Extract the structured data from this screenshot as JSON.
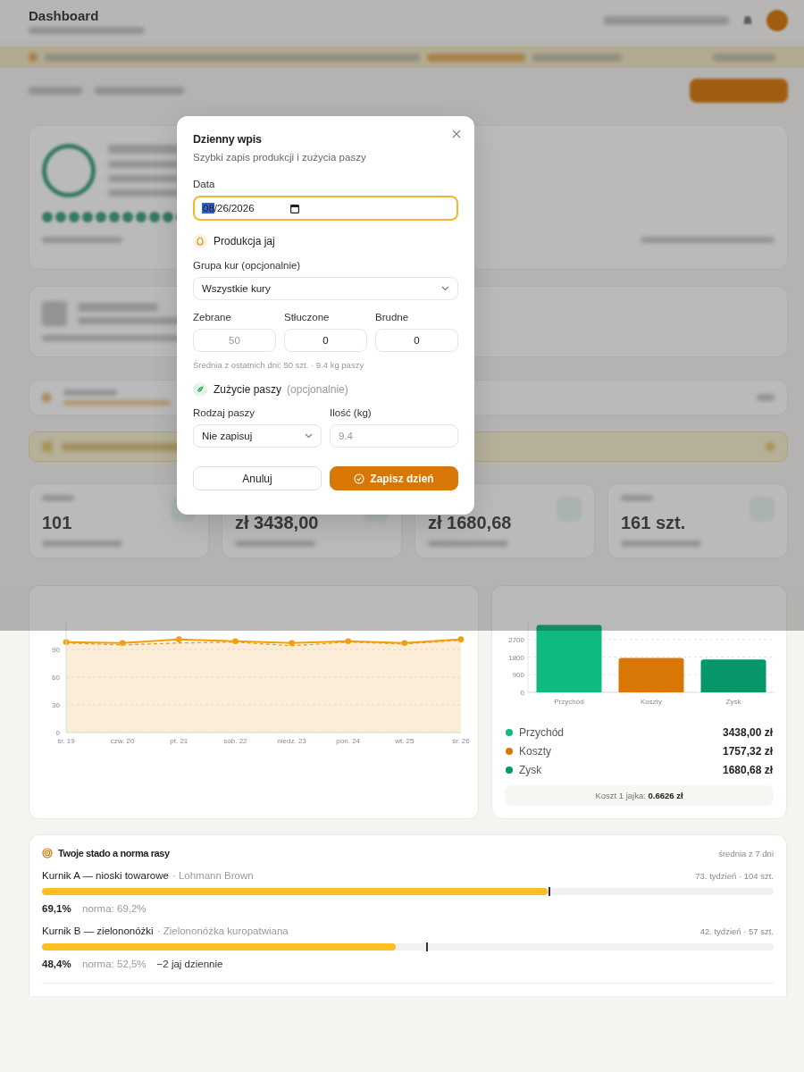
{
  "header": {
    "title": "Dashboard"
  },
  "stats": [
    {
      "value": "101"
    },
    {
      "value": "zł 3438,00"
    },
    {
      "value": "zł 1680,68"
    },
    {
      "value": "161 szt."
    }
  ],
  "modal": {
    "title": "Dzienny wpis",
    "subtitle": "Szybki zapis produkcji i zużycia paszy",
    "date_field": {
      "label": "Data",
      "value": "08/26/2026",
      "focused": true
    },
    "egg_section": {
      "title": "Produkcja jaj",
      "group_select": {
        "label": "Grupa kur (opcjonalnie)",
        "value": "Wszystkie kury"
      },
      "counts": [
        {
          "label": "Zebrane",
          "placeholder": "50"
        },
        {
          "label": "Stłuczone",
          "value": "0"
        },
        {
          "label": "Brudne",
          "value": "0"
        }
      ],
      "hint": "Średnia z ostatnich dni: 50 szt. · 9.4 kg paszy"
    },
    "feed_section": {
      "title": "Zużycie paszy",
      "note": "(opcjonalnie)",
      "fields": [
        {
          "kind": "select",
          "label": "Rodzaj paszy",
          "value": "Nie zapisuj"
        },
        {
          "kind": "input",
          "label": "Ilość (kg)",
          "placeholder": "9.4"
        }
      ]
    },
    "buttons": [
      {
        "kind": "secondary",
        "label": "Anuluj"
      },
      {
        "kind": "primary",
        "label": "Zapisz dzień"
      }
    ]
  },
  "production_chart": {
    "chart_data": {
      "type": "area",
      "grid": true,
      "categories": [
        "śr. 19",
        "czw. 20",
        "pt. 21",
        "sob. 22",
        "niedz. 23",
        "pon. 24",
        "wt. 25",
        "śr. 26"
      ],
      "series": [
        {
          "color": "#f59e0b",
          "marker": true,
          "values": [
            98,
            97,
            101,
            99,
            97,
            99,
            97,
            101
          ]
        },
        {
          "color": "#e89a2c",
          "line_style": "dashed",
          "values": [
            97,
            95,
            97,
            98,
            94,
            98,
            96,
            100
          ]
        }
      ],
      "ylim": [
        0,
        120
      ],
      "yticks": [
        0,
        30,
        60,
        90
      ]
    }
  },
  "finance": {
    "chart_data": {
      "type": "bar",
      "grid": true,
      "categories": [
        "Przychód",
        "Koszty",
        "Zysk"
      ],
      "series": [
        {
          "values": [
            3440,
            1760,
            1680
          ]
        }
      ],
      "ylim": [
        0,
        3600
      ],
      "yticks": [
        0,
        900,
        1800,
        2700
      ]
    },
    "legend": [
      {
        "label": "Przychód",
        "value": "3438,00 zł",
        "color": "#10b981"
      },
      {
        "label": "Koszty",
        "value": "1757,32 zł",
        "color": "#d97706"
      },
      {
        "label": "Zysk",
        "value": "1680,68 zł",
        "color": "#059669"
      }
    ],
    "cost_note": "Koszt 1 jajka: **0.6626 zł**"
  },
  "flock": {
    "title": "Twoje stado a norma rasy",
    "period": "średnia z 7 dni",
    "groups": [
      {
        "name": "Kurnik A — nioski towarowe",
        "breed": "· Lohmann Brown",
        "meta": "73. tydzień · 104 szt.",
        "level": 0.691,
        "target": {
          "level": 0.692
        },
        "rate": "69,1%",
        "norm": "norma: 69,2%"
      },
      {
        "name": "Kurnik B — zielononóżki",
        "breed": "· Zielononóżka kuropatwiana",
        "meta": "42. tydzień · 57 szt.",
        "level": 0.484,
        "target": {
          "level": 0.525
        },
        "rate": "48,4%",
        "norm": "norma: 52,5%",
        "deficit": "−2 jaj dziennie"
      }
    ]
  }
}
